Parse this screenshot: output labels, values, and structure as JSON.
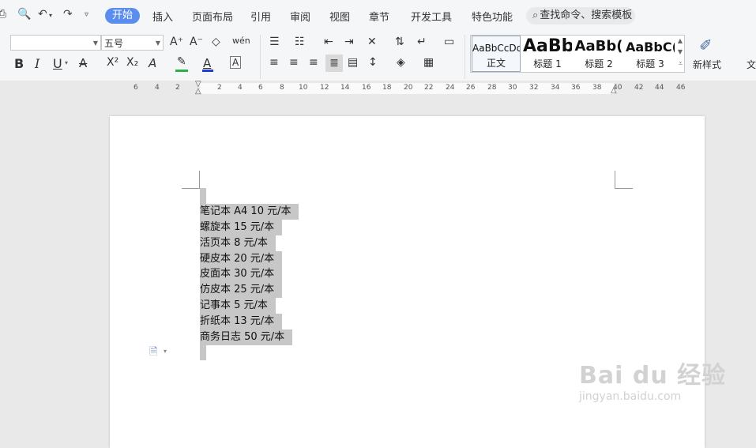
{
  "tabs": [
    "开始",
    "插入",
    "页面布局",
    "引用",
    "审阅",
    "视图",
    "章节",
    "开发工具",
    "特色功能"
  ],
  "search_placeholder": "查找命令、搜索模板",
  "toolbar": {
    "font_name": "",
    "font_size": "五号",
    "btn_bold": "B",
    "btn_italic": "I",
    "btn_underline": "U",
    "btn_strike": "A",
    "btn_super": "X²",
    "btn_sub": "X₂",
    "btn_effect": "A",
    "btn_fontcolor": "A",
    "btn_charborder": "A",
    "btn_phonetic": "wén",
    "btn_grow": "A⁺",
    "btn_shrink": "A⁻",
    "btn_clear": "◇",
    "accent_highlight": "#2bb14a",
    "accent_fontcolor": "#1e3fd0",
    "accent_strike": "#d23b3b"
  },
  "styles": [
    {
      "sample": "AaBbCcDd",
      "label": "正文"
    },
    {
      "sample": "AaBb",
      "label": "标题 1"
    },
    {
      "sample": "AaBb(",
      "label": "标题 2"
    },
    {
      "sample": "AaBbC(",
      "label": "标题 3"
    }
  ],
  "new_style_label": "新样式",
  "next_group_label": "文",
  "ruler_numbers": [
    "6",
    "4",
    "2",
    "",
    "2",
    "4",
    "6",
    "8",
    "10",
    "12",
    "14",
    "16",
    "18",
    "20",
    "22",
    "24",
    "26",
    "28",
    "30",
    "32",
    "34",
    "36",
    "38",
    "40",
    "42",
    "44",
    "46"
  ],
  "document_lines": [
    "笔记本 A4 10 元/本",
    "螺旋本  15 元/本",
    "活页本 8 元/本",
    "硬皮本  20 元/本",
    "皮面本  30 元/本",
    "仿皮本  25 元/本",
    "记事本  5 元/本",
    "折纸本  13 元/本",
    "商务日志  50 元/本"
  ],
  "watermark": {
    "logo": "Bai du 经验",
    "url": "jingyan.baidu.com"
  }
}
